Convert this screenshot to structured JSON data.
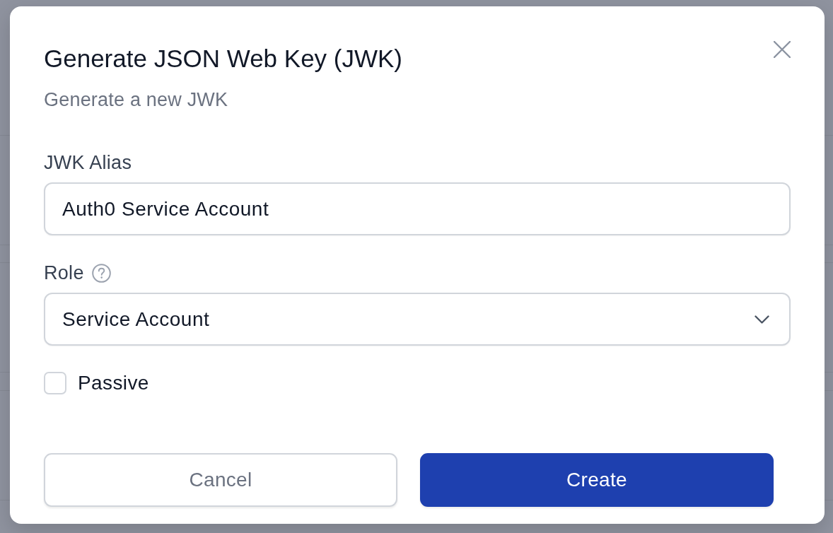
{
  "dialog": {
    "title": "Generate JSON Web Key (JWK)",
    "subtitle": "Generate a new JWK",
    "fields": [
      {
        "kind": "text",
        "label": "JWK Alias",
        "help": false,
        "value": "Auth0 Service Account"
      },
      {
        "kind": "select",
        "label": "Role",
        "help": true,
        "value": "Service Account"
      },
      {
        "kind": "checkbox",
        "label": "Passive",
        "checked": false
      }
    ],
    "buttons": [
      {
        "kind": "secondary",
        "label": "Cancel"
      },
      {
        "kind": "primary",
        "label": "Create"
      }
    ]
  }
}
